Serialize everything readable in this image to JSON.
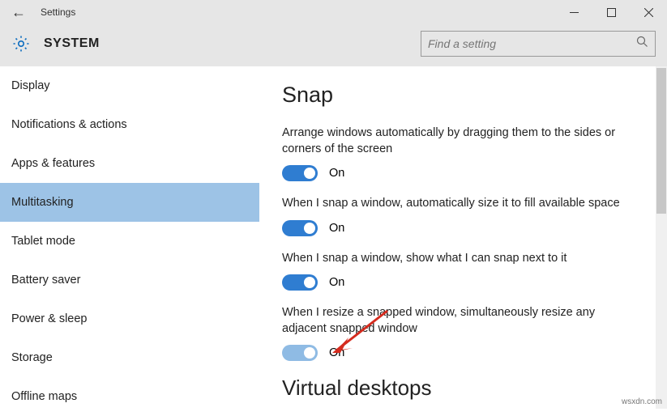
{
  "window": {
    "title": "Settings"
  },
  "header": {
    "section": "SYSTEM",
    "search_placeholder": "Find a setting"
  },
  "sidebar": {
    "items": [
      {
        "label": "Display"
      },
      {
        "label": "Notifications & actions"
      },
      {
        "label": "Apps & features"
      },
      {
        "label": "Multitasking"
      },
      {
        "label": "Tablet mode"
      },
      {
        "label": "Battery saver"
      },
      {
        "label": "Power & sleep"
      },
      {
        "label": "Storage"
      },
      {
        "label": "Offline maps"
      }
    ],
    "selected_index": 3
  },
  "content": {
    "heading": "Snap",
    "settings": [
      {
        "label": "Arrange windows automatically by dragging them to the sides or corners of the screen",
        "state": "On"
      },
      {
        "label": "When I snap a window, automatically size it to fill available space",
        "state": "On"
      },
      {
        "label": "When I snap a window, show what I can snap next to it",
        "state": "On"
      },
      {
        "label": "When I resize a snapped window, simultaneously resize any adjacent snapped window",
        "state": "On"
      }
    ],
    "next_heading": "Virtual desktops"
  },
  "watermark": "wsxdn.com"
}
